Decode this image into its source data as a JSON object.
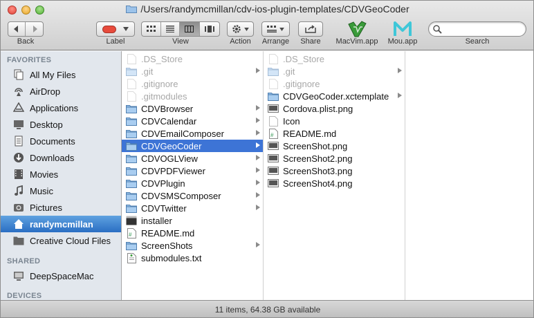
{
  "window": {
    "title": "/Users/randymcmillan/cdv-ios-plugin-templates/CDVGeoCoder"
  },
  "toolbar": {
    "back_label": "Back",
    "label_label": "Label",
    "view_label": "View",
    "action_label": "Action",
    "arrange_label": "Arrange",
    "share_label": "Share",
    "macvim_label": "MacVim.app",
    "mou_label": "Mou.app",
    "search_label": "Search",
    "search_placeholder": "",
    "label_color": "#e84b3c"
  },
  "sidebar": {
    "favorites_header": "FAVORITES",
    "shared_header": "SHARED",
    "devices_header": "DEVICES",
    "favorites": [
      {
        "label": "All My Files",
        "icon": "all-files-icon"
      },
      {
        "label": "AirDrop",
        "icon": "airdrop-icon"
      },
      {
        "label": "Applications",
        "icon": "applications-icon"
      },
      {
        "label": "Desktop",
        "icon": "desktop-icon"
      },
      {
        "label": "Documents",
        "icon": "documents-icon"
      },
      {
        "label": "Downloads",
        "icon": "downloads-icon"
      },
      {
        "label": "Movies",
        "icon": "movies-icon"
      },
      {
        "label": "Music",
        "icon": "music-icon"
      },
      {
        "label": "Pictures",
        "icon": "pictures-icon"
      },
      {
        "label": "randymcmillan",
        "icon": "home-icon"
      },
      {
        "label": "Creative Cloud Files",
        "icon": "folder-icon"
      }
    ],
    "shared": [
      {
        "label": "DeepSpaceMac",
        "icon": "computer-icon"
      }
    ]
  },
  "columns": {
    "col1": [
      {
        "name": ".DS_Store",
        "type": "file",
        "dim": true
      },
      {
        "name": ".git",
        "type": "folder",
        "dim": true,
        "arrow": true
      },
      {
        "name": ".gitignore",
        "type": "file",
        "dim": true
      },
      {
        "name": ".gitmodules",
        "type": "file",
        "dim": true
      },
      {
        "name": "CDVBrowser",
        "type": "folder",
        "arrow": true
      },
      {
        "name": "CDVCalendar",
        "type": "folder",
        "arrow": true
      },
      {
        "name": "CDVEmailComposer",
        "type": "folder",
        "arrow": true
      },
      {
        "name": "CDVGeoCoder",
        "type": "folder",
        "arrow": true,
        "selected": true
      },
      {
        "name": "CDVOGLView",
        "type": "folder",
        "arrow": true
      },
      {
        "name": "CDVPDFViewer",
        "type": "folder",
        "arrow": true
      },
      {
        "name": "CDVPlugin",
        "type": "folder",
        "arrow": true
      },
      {
        "name": "CDVSMSComposer",
        "type": "folder",
        "arrow": true
      },
      {
        "name": "CDVTwitter",
        "type": "folder",
        "arrow": true
      },
      {
        "name": "installer",
        "type": "exec"
      },
      {
        "name": "README.md",
        "type": "md"
      },
      {
        "name": "ScreenShots",
        "type": "folder",
        "arrow": true
      },
      {
        "name": "submodules.txt",
        "type": "txt"
      }
    ],
    "col2": [
      {
        "name": ".DS_Store",
        "type": "file",
        "dim": true
      },
      {
        "name": ".git",
        "type": "folder",
        "dim": true,
        "arrow": true
      },
      {
        "name": ".gitignore",
        "type": "file",
        "dim": true
      },
      {
        "name": "CDVGeoCoder.xctemplate",
        "type": "folder",
        "arrow": true
      },
      {
        "name": "Cordova.plist.png",
        "type": "img"
      },
      {
        "name": "Icon",
        "type": "file"
      },
      {
        "name": "README.md",
        "type": "md"
      },
      {
        "name": "ScreenShot.png",
        "type": "img"
      },
      {
        "name": "ScreenShot2.png",
        "type": "img"
      },
      {
        "name": "ScreenShot3.png",
        "type": "img"
      },
      {
        "name": "ScreenShot4.png",
        "type": "img"
      }
    ]
  },
  "status": {
    "text": "11 items, 64.38 GB available"
  }
}
